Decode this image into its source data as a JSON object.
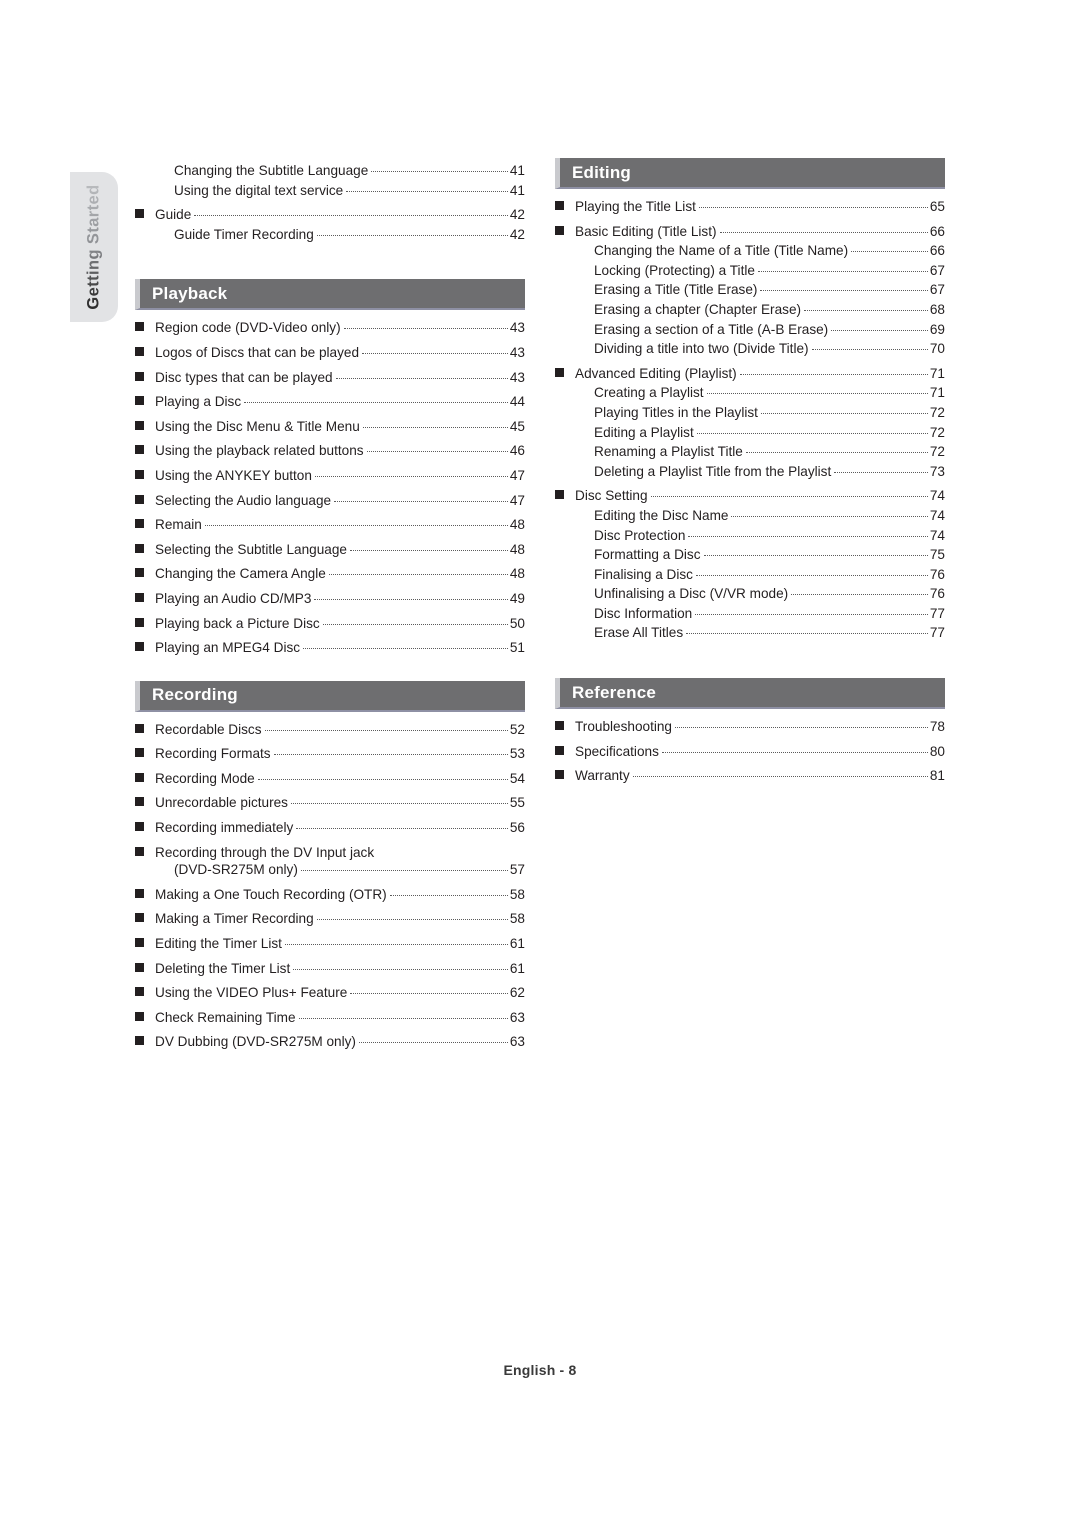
{
  "side_tab": {
    "label": "Getting Started"
  },
  "footer": {
    "text": "English - 8"
  },
  "left_column": {
    "lead_entries": [
      {
        "label": "Changing the Subtitle Language",
        "page": "41",
        "level": 2,
        "bullet": false
      },
      {
        "label": "Using the digital text service",
        "page": "41",
        "level": 2,
        "bullet": false
      },
      {
        "label": "Guide",
        "page": "42",
        "level": 1,
        "bullet": true
      },
      {
        "label": "Guide Timer Recording",
        "page": "42",
        "level": 2,
        "bullet": false
      }
    ],
    "sections": [
      {
        "title": "Playback",
        "entries": [
          {
            "label": "Region code (DVD-Video only)",
            "page": "43",
            "level": 1,
            "bullet": true
          },
          {
            "label": "Logos of Discs that can be played",
            "page": "43",
            "level": 1,
            "bullet": true
          },
          {
            "label": "Disc types that can be played",
            "page": "43",
            "level": 1,
            "bullet": true
          },
          {
            "label": "Playing a Disc",
            "page": "44",
            "level": 1,
            "bullet": true
          },
          {
            "label": "Using the Disc Menu & Title Menu",
            "page": "45",
            "level": 1,
            "bullet": true
          },
          {
            "label": "Using the playback related buttons",
            "page": "46",
            "level": 1,
            "bullet": true
          },
          {
            "label": "Using the ANYKEY button",
            "page": "47",
            "level": 1,
            "bullet": true
          },
          {
            "label": "Selecting the Audio language",
            "page": "47",
            "level": 1,
            "bullet": true
          },
          {
            "label": "Remain",
            "page": "48",
            "level": 1,
            "bullet": true
          },
          {
            "label": "Selecting the Subtitle Language",
            "page": "48",
            "level": 1,
            "bullet": true
          },
          {
            "label": "Changing the Camera Angle",
            "page": "48",
            "level": 1,
            "bullet": true
          },
          {
            "label": "Playing an Audio CD/MP3",
            "page": "49",
            "level": 1,
            "bullet": true
          },
          {
            "label": "Playing back a Picture Disc",
            "page": "50",
            "level": 1,
            "bullet": true
          },
          {
            "label": "Playing an MPEG4 Disc",
            "page": "51",
            "level": 1,
            "bullet": true
          }
        ]
      },
      {
        "title": "Recording",
        "entries": [
          {
            "label": "Recordable Discs",
            "page": "52",
            "level": 1,
            "bullet": true
          },
          {
            "label": "Recording Formats",
            "page": "53",
            "level": 1,
            "bullet": true
          },
          {
            "label": "Recording Mode",
            "page": "54",
            "level": 1,
            "bullet": true
          },
          {
            "label": "Unrecordable pictures",
            "page": "55",
            "level": 1,
            "bullet": true
          },
          {
            "label": "Recording immediately",
            "page": "56",
            "level": 1,
            "bullet": true
          },
          {
            "label": "Recording through the DV Input jack",
            "page": "",
            "level": 1,
            "bullet": true,
            "noleader": true
          },
          {
            "label": "(DVD-SR275M only)",
            "page": "57",
            "level": 2,
            "bullet": false,
            "continuation": true
          },
          {
            "label": "Making a One Touch Recording (OTR)",
            "page": "58",
            "level": 1,
            "bullet": true
          },
          {
            "label": "Making a Timer Recording ",
            "page": "58",
            "level": 1,
            "bullet": true
          },
          {
            "label": "Editing the Timer List",
            "page": "61",
            "level": 1,
            "bullet": true
          },
          {
            "label": "Deleting the Timer List",
            "page": "61",
            "level": 1,
            "bullet": true
          },
          {
            "label": "Using the VIDEO Plus+ Feature",
            "page": "62",
            "level": 1,
            "bullet": true
          },
          {
            "label": "Check Remaining Time",
            "page": "63",
            "level": 1,
            "bullet": true
          },
          {
            "label": "DV Dubbing (DVD-SR275M only)",
            "page": "63",
            "level": 1,
            "bullet": true
          }
        ]
      }
    ]
  },
  "right_column": {
    "sections": [
      {
        "title": "Editing",
        "entries": [
          {
            "label": "Playing the Title List",
            "page": "65",
            "level": 1,
            "bullet": true
          },
          {
            "label": "Basic Editing (Title List)",
            "page": "66",
            "level": 1,
            "bullet": true
          },
          {
            "label": "Changing the Name of a Title (Title Name)",
            "page": "66",
            "level": 2,
            "bullet": false
          },
          {
            "label": "Locking (Protecting) a Title ",
            "page": "67",
            "level": 2,
            "bullet": false
          },
          {
            "label": "Erasing a Title (Title Erase) ",
            "page": "67",
            "level": 2,
            "bullet": false
          },
          {
            "label": "Erasing a chapter (Chapter Erase) ",
            "page": "68",
            "level": 2,
            "bullet": false
          },
          {
            "label": "Erasing a section of a Title (A-B Erase) ",
            "page": "69",
            "level": 2,
            "bullet": false
          },
          {
            "label": "Dividing a title into two (Divide Title) ",
            "page": "70",
            "level": 2,
            "bullet": false
          },
          {
            "label": "Advanced Editing (Playlist)",
            "page": "71",
            "level": 1,
            "bullet": true
          },
          {
            "label": "Creating a Playlist ",
            "page": "71",
            "level": 2,
            "bullet": false
          },
          {
            "label": "Playing Titles in the Playlist ",
            "page": "72",
            "level": 2,
            "bullet": false
          },
          {
            "label": "Editing a Playlist ",
            "page": "72",
            "level": 2,
            "bullet": false
          },
          {
            "label": "Renaming a Playlist Title ",
            "page": "72",
            "level": 2,
            "bullet": false
          },
          {
            "label": "Deleting a Playlist Title from the Playlist ",
            "page": "73",
            "level": 2,
            "bullet": false
          },
          {
            "label": "Disc Setting",
            "page": "74",
            "level": 1,
            "bullet": true
          },
          {
            "label": "Editing the Disc Name ",
            "page": "74",
            "level": 2,
            "bullet": false
          },
          {
            "label": "Disc Protection",
            "page": "74",
            "level": 2,
            "bullet": false
          },
          {
            "label": "Formatting a Disc",
            "page": "75",
            "level": 2,
            "bullet": false
          },
          {
            "label": "Finalising a Disc",
            "page": "76",
            "level": 2,
            "bullet": false
          },
          {
            "label": "Unfinalising a Disc (V/VR mode) ",
            "page": "76",
            "level": 2,
            "bullet": false
          },
          {
            "label": "Disc Information ",
            "page": "77",
            "level": 2,
            "bullet": false
          },
          {
            "label": "Erase All Titles ",
            "page": "77",
            "level": 2,
            "bullet": false
          }
        ]
      },
      {
        "title": "Reference",
        "entries": [
          {
            "label": "Troubleshooting",
            "page": "78",
            "level": 1,
            "bullet": true
          },
          {
            "label": "Specifications",
            "page": "80",
            "level": 1,
            "bullet": true
          },
          {
            "label": "Warranty ",
            "page": "81",
            "level": 1,
            "bullet": true
          }
        ]
      }
    ]
  },
  "colors": {
    "section_bar": "#6e6e70",
    "section_bar_edge": "#c9cace",
    "section_bar_underline": "#8e90a4",
    "tab_background": "#e2e3e5",
    "bullet": "#231f20",
    "text": "#231f20"
  }
}
